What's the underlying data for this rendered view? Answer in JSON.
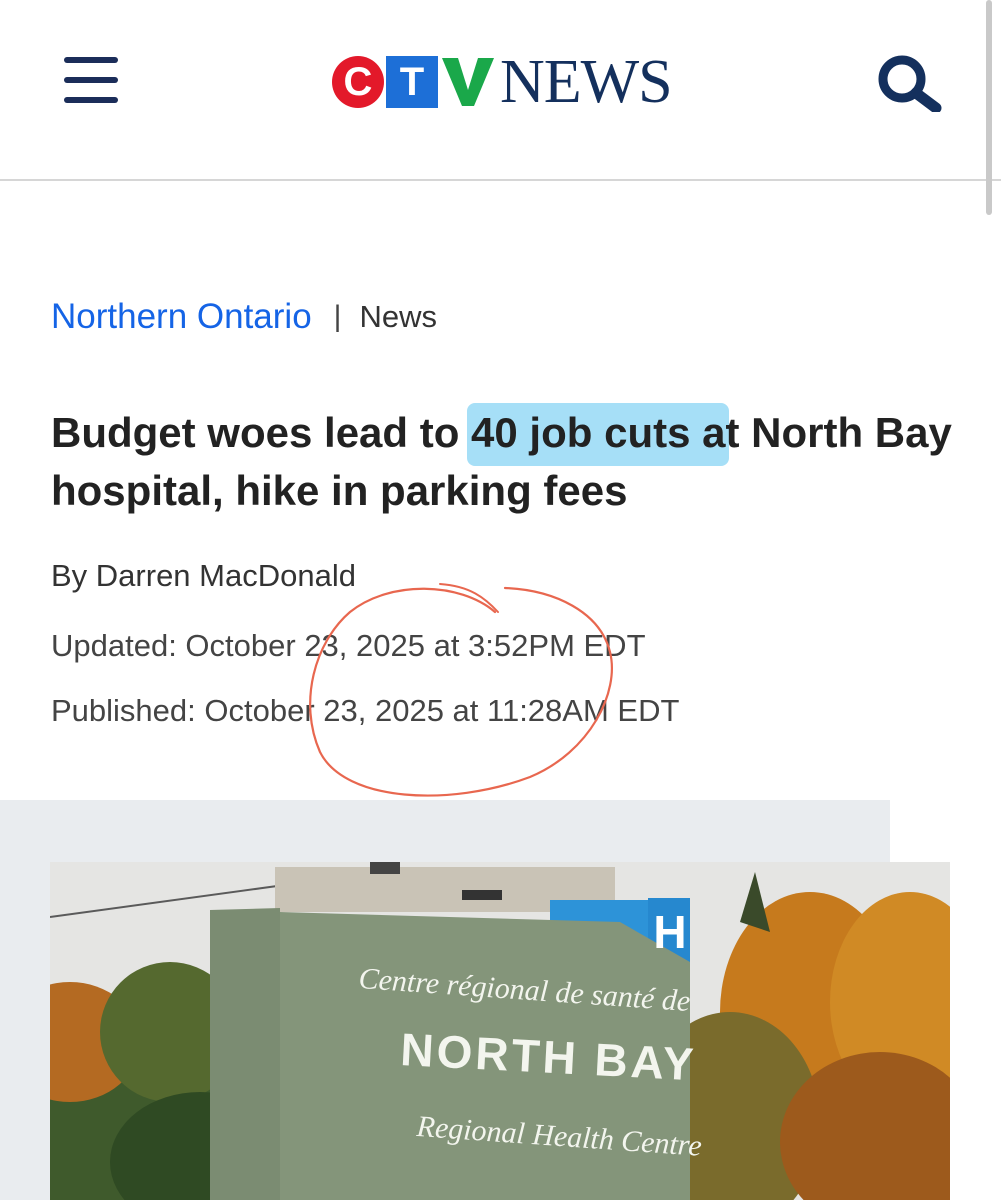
{
  "header": {
    "menu_icon": "hamburger-menu-icon",
    "logo": {
      "c": "C",
      "t": "T",
      "v": "V",
      "news": "NEWS"
    },
    "search_icon": "search-icon",
    "colors": {
      "navy": "#14305d",
      "red": "#e3192a",
      "blue": "#1d6fd7",
      "green": "#1aa84a"
    }
  },
  "article": {
    "section": "Northern Ontario",
    "separator": "|",
    "subsection": "News",
    "headline_before": "Budget woes lead to ",
    "headline_highlight": "40 job cuts a",
    "headline_after": "t North Bay hospital, hike in parking fees",
    "byline": "By Darren MacDonald",
    "updated": "Updated: October 23, 2025 at 3:52PM EDT",
    "published": "Published: October 23, 2025 at 11:28AM EDT",
    "highlight_color": "#a6dff7",
    "link_color": "#1564e6"
  },
  "photo": {
    "sign_line1": "Centre régional de santé de",
    "sign_line2": "NORTH BAY",
    "sign_line3": "Regional Health Centre",
    "hospital_letter": "H"
  }
}
